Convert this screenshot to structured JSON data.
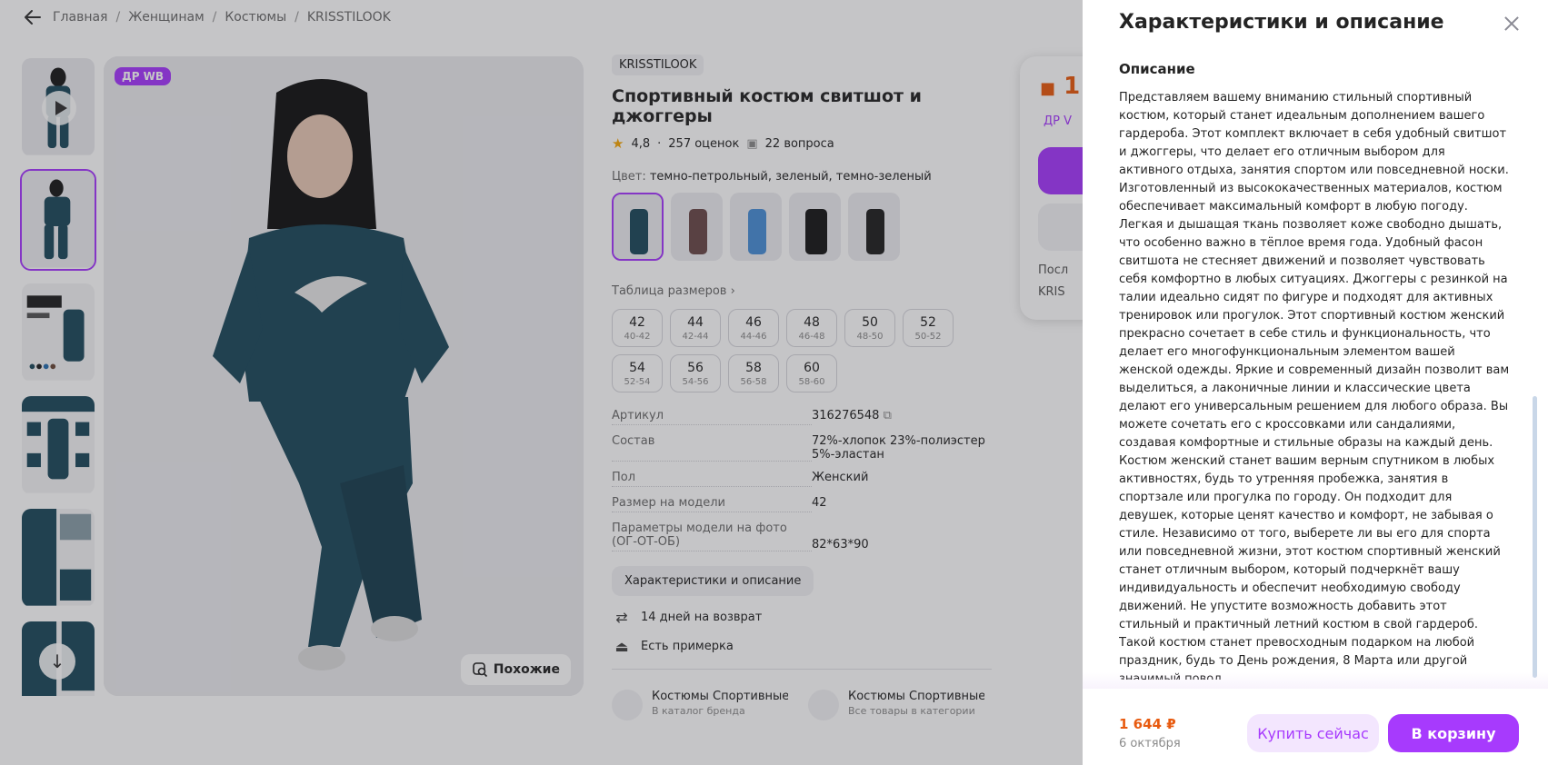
{
  "breadcrumbs": [
    "Главная",
    "Женщинам",
    "Костюмы",
    "KRISSTILOOK"
  ],
  "gallery": {
    "badge": "ДР WB",
    "similar_label": "Похожие",
    "thumb_count": 6
  },
  "product": {
    "brand": "KRISSTILOOK",
    "title": "Спортивный костюм свитшот и джоггеры",
    "rating": "4,8",
    "reviews": "257 оценок",
    "questions": "22 вопроса",
    "color_label": "Цвет:",
    "color_value": "темно-петрольный, зеленый, темно-зеленый",
    "size_table_label": "Таблица размеров",
    "sizes": [
      {
        "n": "42",
        "r": "40-42"
      },
      {
        "n": "44",
        "r": "42-44"
      },
      {
        "n": "46",
        "r": "44-46"
      },
      {
        "n": "48",
        "r": "46-48"
      },
      {
        "n": "50",
        "r": "48-50"
      },
      {
        "n": "52",
        "r": "50-52"
      },
      {
        "n": "54",
        "r": "52-54"
      },
      {
        "n": "56",
        "r": "54-56"
      },
      {
        "n": "58",
        "r": "56-58"
      },
      {
        "n": "60",
        "r": "58-60"
      }
    ],
    "specs": [
      {
        "k": "Артикул",
        "v": "316276548"
      },
      {
        "k": "Состав",
        "v": "72%-хлопок 23%-полиэстер 5%-эластан"
      },
      {
        "k": "Пол",
        "v": "Женский"
      },
      {
        "k": "Размер на модели",
        "v": "42"
      },
      {
        "k": "Параметры модели на фото (ОГ-ОТ-ОБ)",
        "v": "82*63*90"
      }
    ],
    "spec_button": "Характеристики и описание",
    "return_text": "14 дней на возврат",
    "fitting_text": "Есть примерка",
    "categories": [
      {
        "t1": "Костюмы Спортивные К",
        "t2": "В каталог бренда"
      },
      {
        "t1": "Костюмы Спортивные",
        "t2": "Все товары в категории"
      }
    ]
  },
  "price_card": {
    "price_partial": "1",
    "dr_partial": "ДР V",
    "line1": "Посл",
    "line2": "KRIS"
  },
  "drawer": {
    "title": "Характеристики и описание",
    "section": "Описание",
    "description": "Представляем вашему вниманию стильный спортивный костюм, который станет идеальным дополнением вашего гардероба. Этот комплект включает в себя удобный свитшот и джоггеры, что делает его отличным выбором для активного отдыха, занятия спортом или повседневной носки. Изготовленный из высококачественных материалов, костюм обеспечивает максимальный комфорт в любую погоду. Легкая и дышащая ткань позволяет коже свободно дышать, что особенно важно в тёплое время года. Удобный фасон свитшота не стесняет движений и позволяет чувствовать себя комфортно в любых ситуациях. Джоггеры с резинкой на талии идеально сидят по фигуре и подходят для активных тренировок или прогулок. Этот спортивный костюм женский прекрасно сочетает в себе стиль и функциональность, что делает его многофункциональным элементом вашей женской одежды. Яркие и современный дизайн позволит вам выделиться, а лаконичные линии и классические цвета делают его универсальным решением для любого образа. Вы можете сочетать его с кроссовками или сандалиями, создавая комфортные и стильные образы на каждый день. Костюм женский станет вашим верным спутником в любых активностях, будь то утренняя пробежка, занятия в спортзале или прогулка по городу. Он подходит для девушек, которые ценят качество и комфорт, не забывая о стиле. Независимо от того, выберете ли вы его для спорта или повседневной жизни, этот костюм спортивный женский станет отличным выбором, который подчеркнёт вашу индивидуальность и обеспечит необходимую свободу движений. Не упустите возможность добавить этот стильный и практичный летний костюм в свой гардероб. Такой костюм станет превосходным подарком на любой праздник, будь то День рождения, 8 Марта или другой значимый повод.",
    "price": "1 644 ₽",
    "date": "6 октября",
    "buy_now": "Купить сейчас",
    "to_cart": "В корзину"
  },
  "colors": {
    "accent": "#a73afd",
    "price": "#e85b10",
    "garment": "#1f4a5c"
  }
}
